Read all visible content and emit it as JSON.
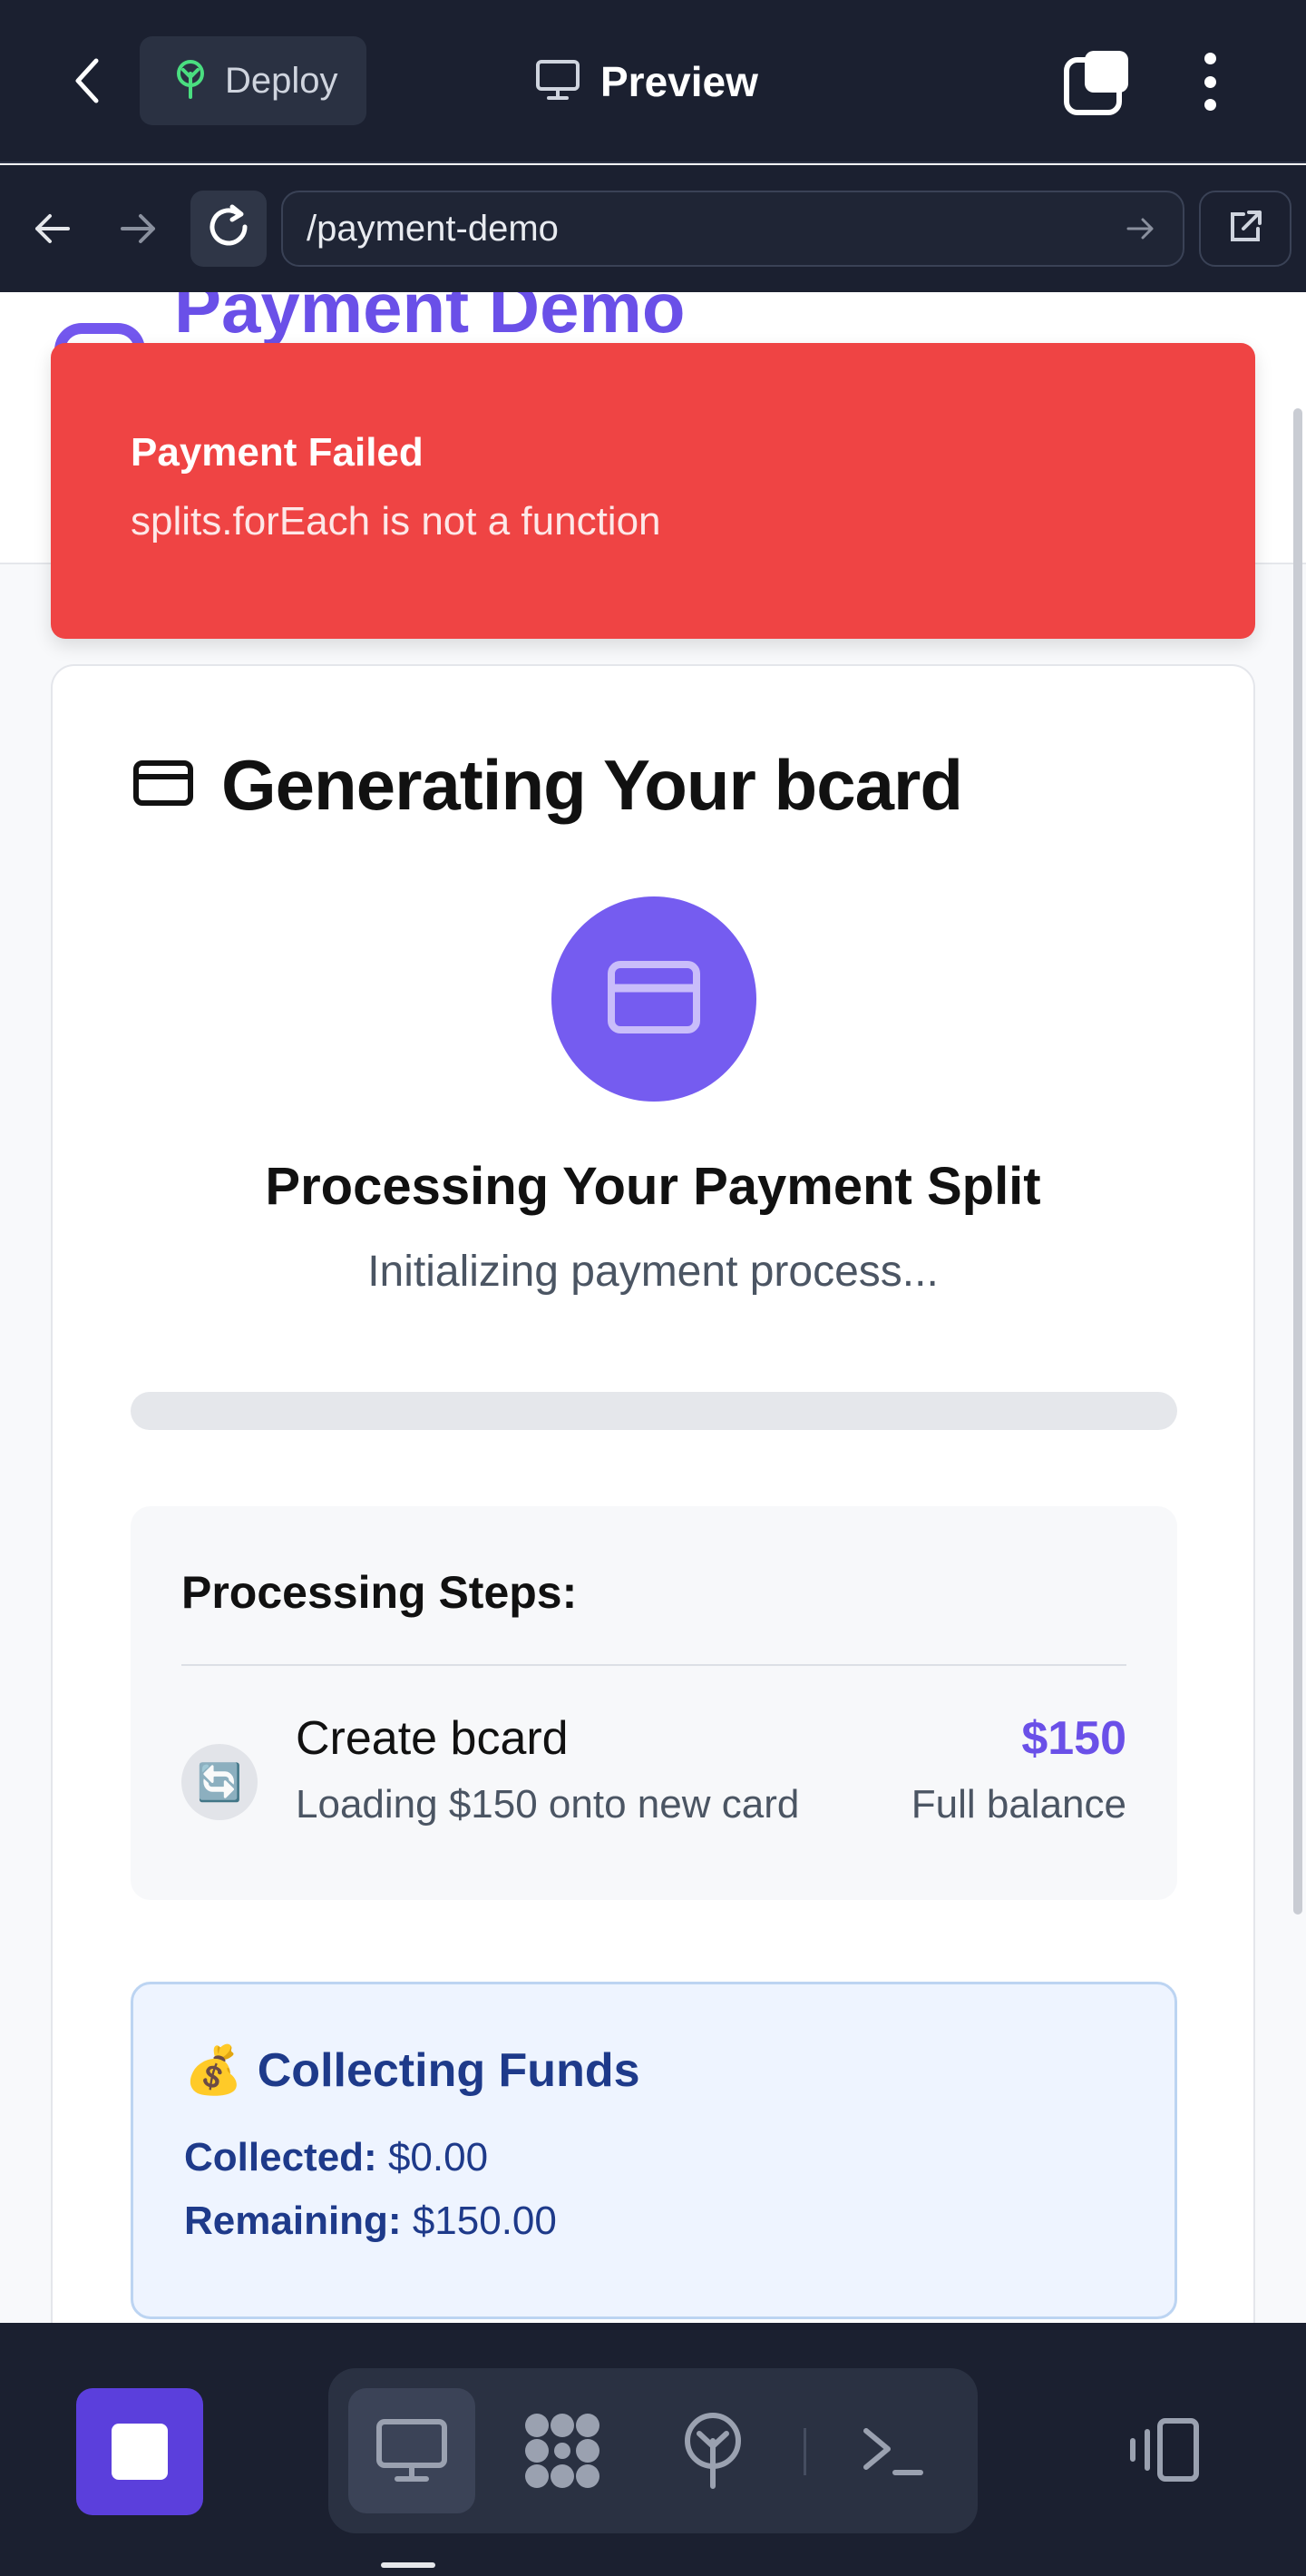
{
  "topbar": {
    "deploy_label": "Deploy",
    "preview_label": "Preview"
  },
  "browser": {
    "url": "/payment-demo"
  },
  "page": {
    "title": "Payment Demo"
  },
  "toast": {
    "title": "Payment Failed",
    "message": "splits.forEach is not a function",
    "color": "#ef4444"
  },
  "card": {
    "title": "Generating Your bcard",
    "processing_title": "Processing Your Payment Split",
    "processing_status": "Initializing payment process...",
    "progress_percent": 0,
    "steps": {
      "title": "Processing Steps:",
      "items": [
        {
          "icon": "🔄",
          "name": "Create bcard",
          "description": "Loading $150 onto new card",
          "amount": "$150",
          "note": "Full balance"
        }
      ]
    },
    "funds": {
      "emoji": "💰",
      "title": "Collecting Funds",
      "collected_label": "Collected:",
      "collected_value": "$0.00",
      "remaining_label": "Remaining:",
      "remaining_value": "$150.00"
    }
  },
  "bottombar": {
    "tools": [
      "monitor-icon",
      "apps-icon",
      "deploy-tree-icon",
      "terminal-icon"
    ]
  },
  "colors": {
    "accent": "#755cf0",
    "dark_bg": "#1b2030"
  }
}
